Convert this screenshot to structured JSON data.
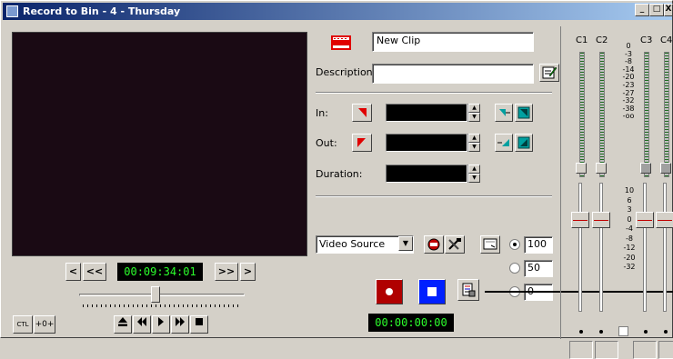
{
  "window": {
    "title": "Record to Bin - 4 - Thursday",
    "btn_min": "_",
    "btn_max": "□",
    "btn_close": "X"
  },
  "clip": {
    "name": "New Clip",
    "description_label": "Description:",
    "description_value": ""
  },
  "marks": {
    "in_label": "In:",
    "out_label": "Out:",
    "duration_label": "Duration:"
  },
  "transport": {
    "timecode": "00:09:34:01",
    "step_back": "<",
    "rewind_label": "<<",
    "ffwd_label": ">>",
    "step_fwd": ">",
    "ctl_label": "CTL",
    "offset_label": "+0+",
    "shuttle_position": 0.46
  },
  "record": {
    "source": "Video Source",
    "timecode": "00:00:00:00"
  },
  "quality": {
    "options": [
      "100",
      "50",
      "0"
    ],
    "selected": "100"
  },
  "mixer": {
    "channels": [
      "C1",
      "C2",
      "C3",
      "C4"
    ],
    "db_scale": [
      "0",
      "-3",
      "-8",
      "-14",
      "-20",
      "-23",
      "-27",
      "-32",
      "-38",
      "-oo"
    ],
    "fader_scale": [
      "10",
      "6",
      "3",
      "0",
      "-4",
      "-8",
      "-12",
      "-20",
      "-32"
    ]
  },
  "colors": {
    "timecode_green": "#2cff2c",
    "record_red": "#b00000",
    "stop_blue": "#0020ff",
    "title_start": "#0a246a",
    "title_end": "#a6caf0"
  }
}
